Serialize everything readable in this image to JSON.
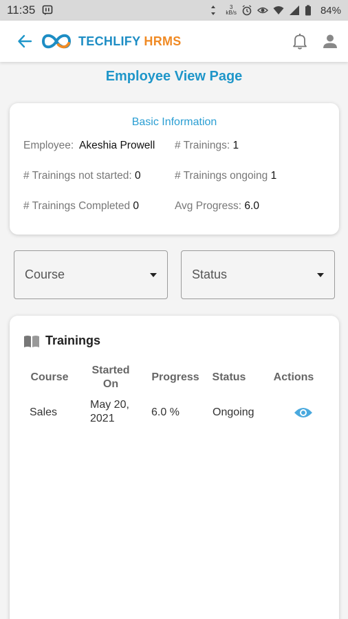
{
  "status_bar": {
    "time": "11:35",
    "net_speed_top": "3",
    "net_speed_unit": "kB/s",
    "battery": "84%"
  },
  "app_bar": {
    "brand_part1": "TECHLIFY",
    "brand_part2": "HRMS"
  },
  "page_title": "Employee View Page",
  "basic_info": {
    "title": "Basic Information",
    "employee_label": "Employee:",
    "employee_value": "Akeshia Prowell",
    "trainings_label": "# Trainings:",
    "trainings_value": "1",
    "not_started_label": "# Trainings not started:",
    "not_started_value": "0",
    "ongoing_label": "# Trainings ongoing",
    "ongoing_value": "1",
    "completed_label": "# Trainings Completed",
    "completed_value": "0",
    "avg_progress_label": "Avg Progress:",
    "avg_progress_value": "6.0"
  },
  "filters": {
    "course_label": "Course",
    "status_label": "Status"
  },
  "trainings": {
    "title": "Trainings",
    "columns": [
      "Course",
      "Started On",
      "Progress",
      "Status",
      "Actions"
    ],
    "column_started_l1": "Started",
    "column_started_l2": "On",
    "rows": [
      {
        "course": "Sales",
        "started_l1": "May 20,",
        "started_l2": "2021",
        "progress": "6.0 %",
        "status": "Ongoing"
      }
    ]
  },
  "colors": {
    "accent": "#1f96c9",
    "brand_orange": "#f08a24",
    "eye_icon": "#4aa9de"
  }
}
